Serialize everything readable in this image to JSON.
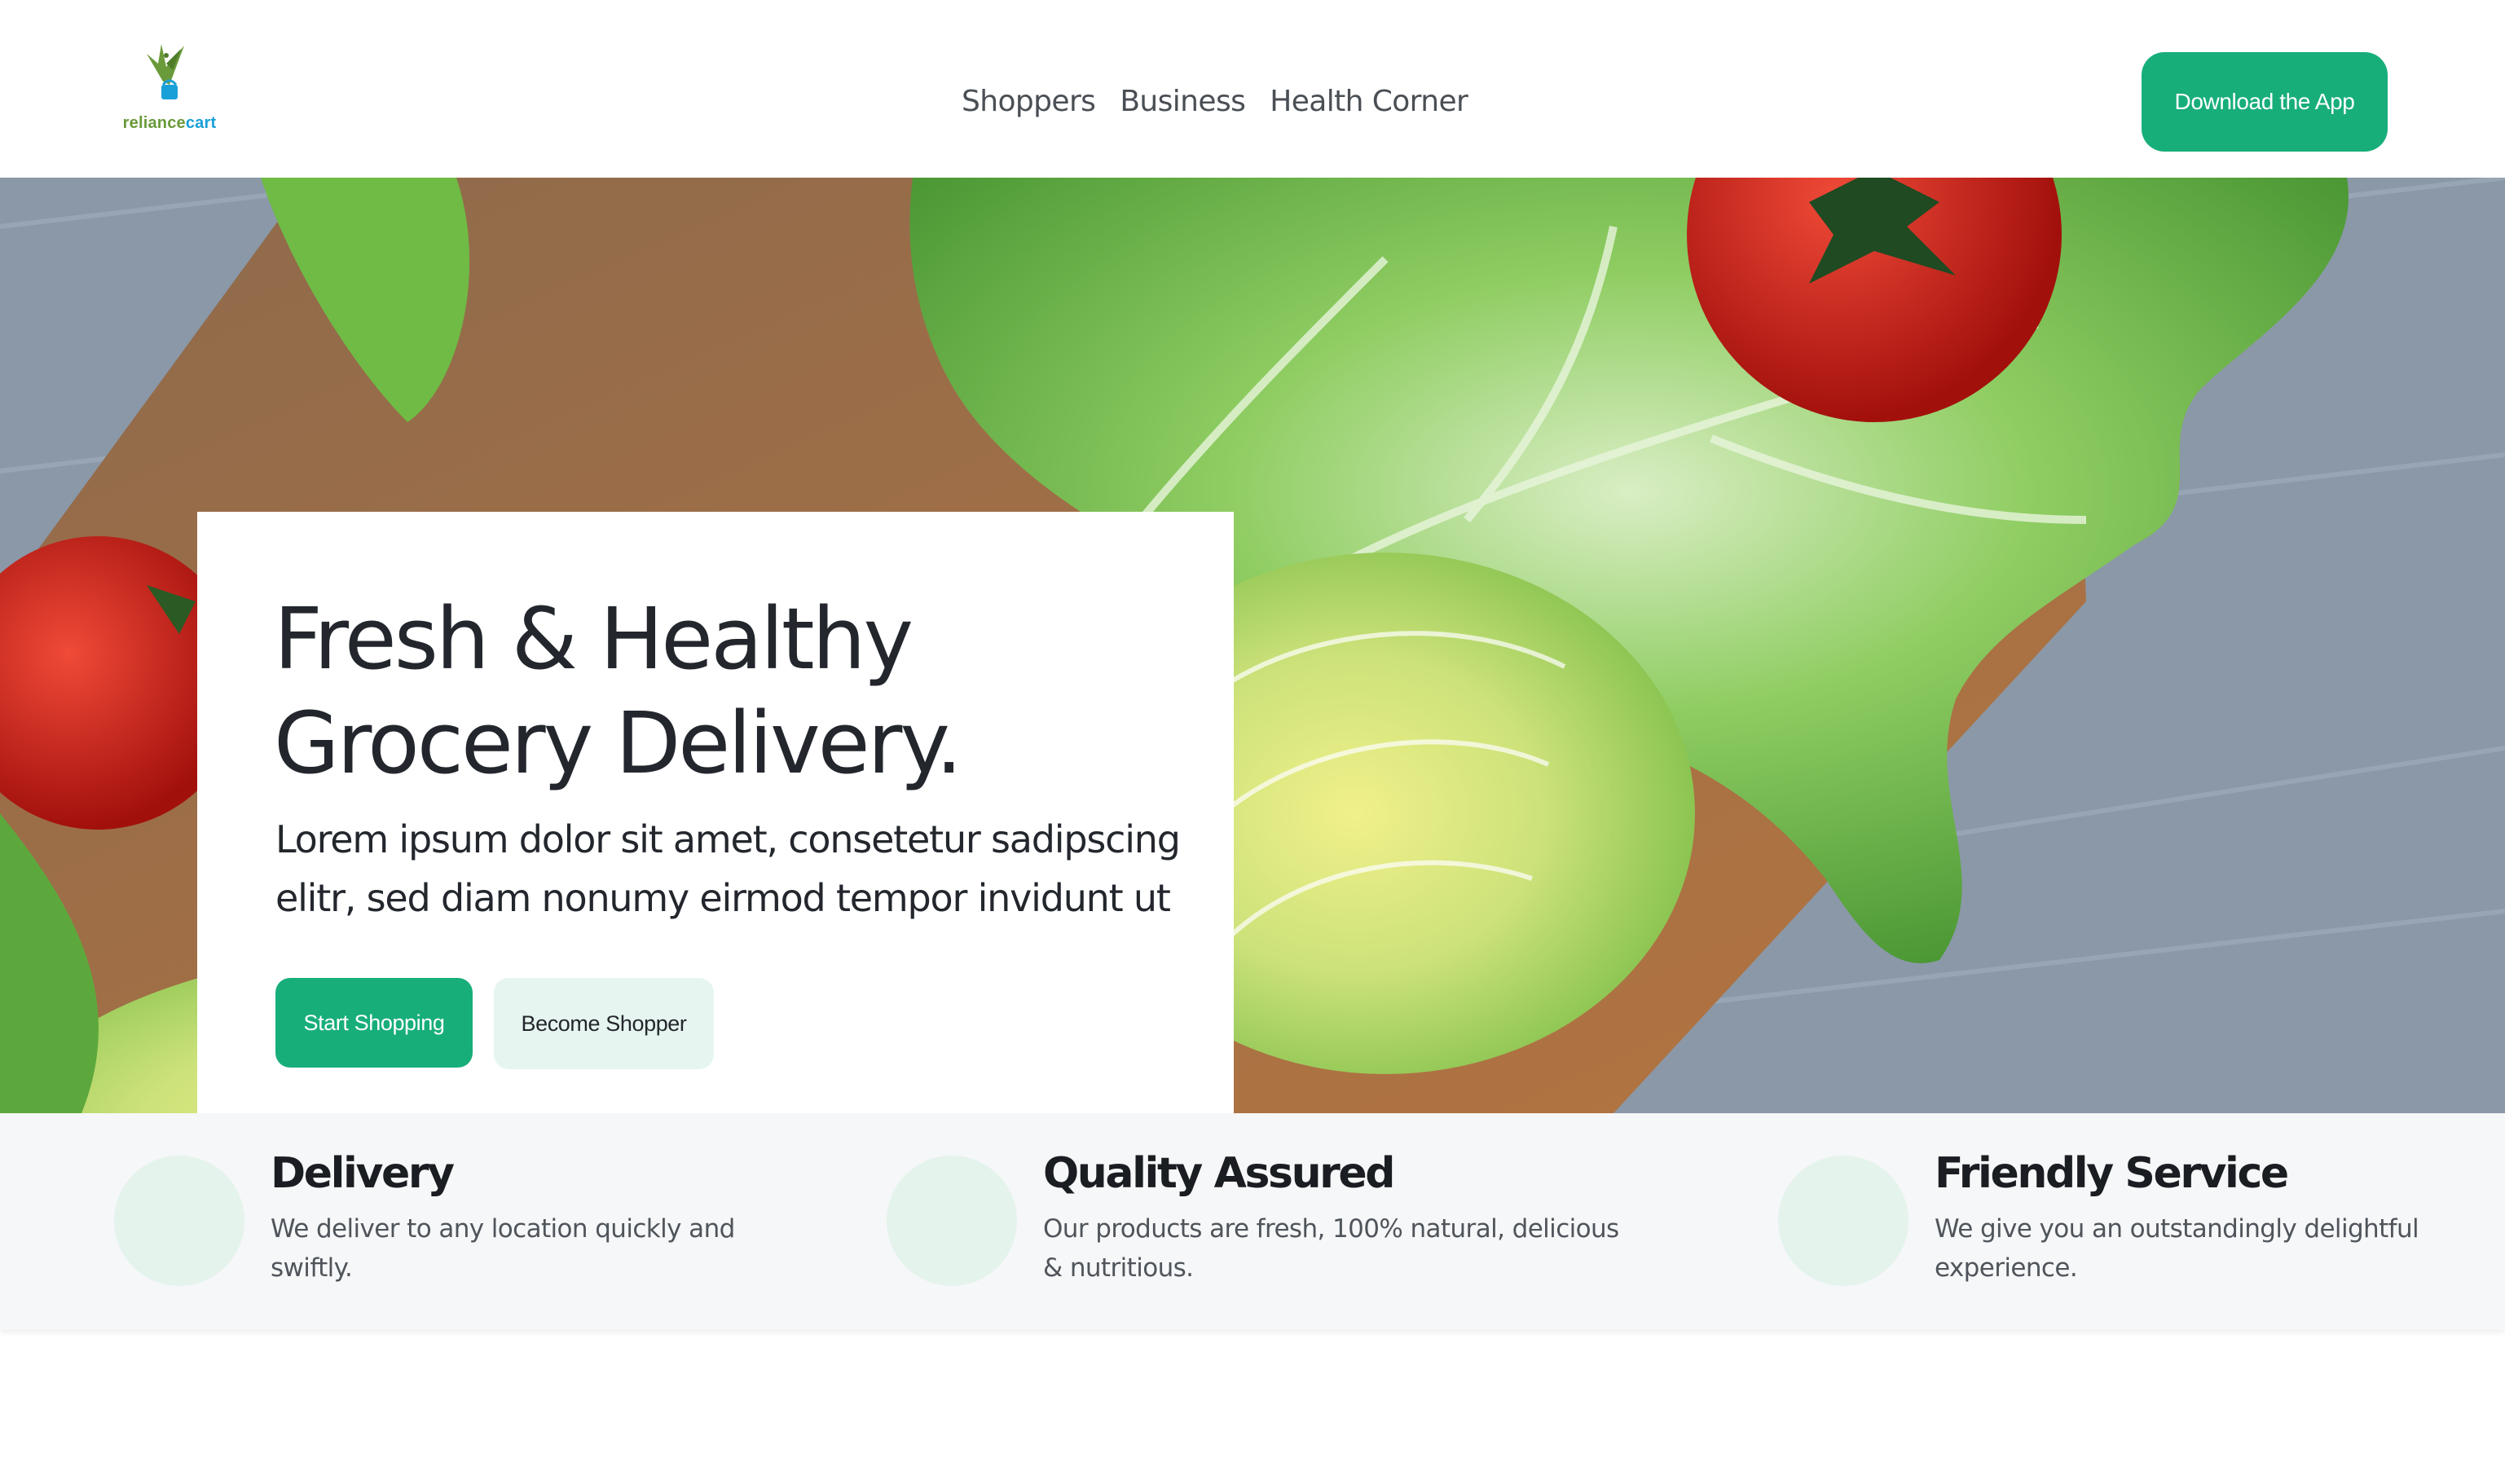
{
  "brand": {
    "logo_text_part1": "reliance",
    "logo_text_part2": "cart"
  },
  "nav": {
    "items": [
      {
        "label": "Shoppers"
      },
      {
        "label": "Business"
      },
      {
        "label": "Health Corner"
      }
    ]
  },
  "header": {
    "download_label": "Download the App"
  },
  "hero": {
    "title_line1": "Fresh & Healthy",
    "title_line2": "Grocery Delivery.",
    "subtitle": "Lorem ipsum dolor sit amet, consetetur sadipscing elitr, sed diam nonumy eirmod tempor invidunt ut",
    "primary_button": "Start Shopping",
    "secondary_button": "Become Shopper"
  },
  "features": [
    {
      "title": "Delivery",
      "text": "We deliver to any location quickly and swiftly."
    },
    {
      "title": "Quality Assured",
      "text": "Our products are fresh, 100% natural, delicious & nutritious."
    },
    {
      "title": "Friendly Service",
      "text": "We give you an outstandingly delightful experience."
    }
  ],
  "colors": {
    "accent": "#17ae7a",
    "accent_light": "#e6f5ef",
    "logo_green": "#6a9a3a",
    "logo_blue": "#1aa0d8"
  }
}
